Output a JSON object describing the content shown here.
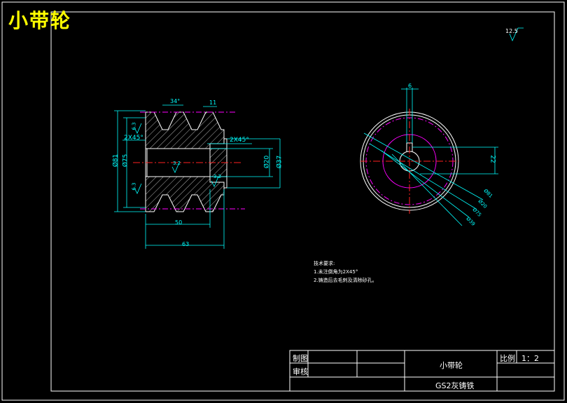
{
  "title": "小带轮",
  "roughness_global": "12.5",
  "dims": {
    "groove_angle": "34°",
    "pitch": "11",
    "chamfer_left": "2X45°",
    "chamfer_right": "2X45°",
    "roughness_a": "6.3",
    "roughness_b": "6.3",
    "roughness_bore": "3.2",
    "roughness_face": "3.2",
    "dia_81": "Ø81",
    "dia_75": "Ø75",
    "dia_20": "Ø20",
    "dia_37": "Ø37",
    "len_50": "50",
    "len_63": "63",
    "key_width": "6",
    "key_depth": "22",
    "r_81": "Ø81",
    "r_20": "Ø20",
    "r_75": "Ø75",
    "r_39": "Ø39"
  },
  "notes": {
    "heading": "技术要求:",
    "line1": "1.未注倒角为2X45°",
    "line2": "2.铸造后去毛刺及清除砂孔。"
  },
  "title_block": {
    "drawn_label": "制图",
    "checked_label": "审核",
    "part_name": "小带轮",
    "material": "GS2灰铸铁",
    "scale_label": "比例",
    "scale_value": "1：2"
  }
}
